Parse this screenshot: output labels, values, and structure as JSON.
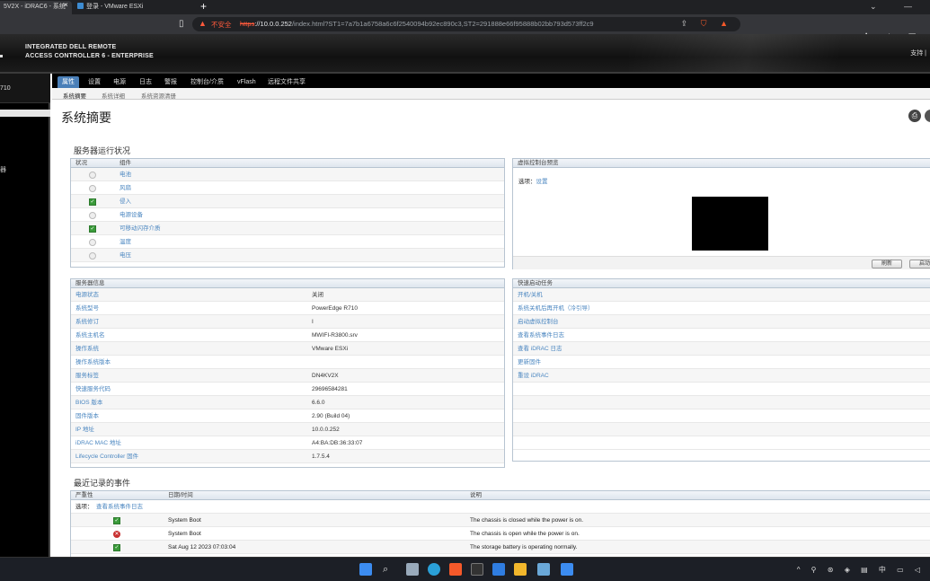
{
  "browser": {
    "tab1_title": "5V2X - iDRAC6 - 系统",
    "tab2_title": "登录 - VMware ESXi",
    "new_tab": "+",
    "close_x": "×",
    "security_label": "不安全",
    "url_scheme": "https",
    "url_host": "://10.0.0.252",
    "url_path": "/index.html?ST1=7a7b1a6758a6c6f2540094b92ec890c3,ST2=291888e66f95888b02bb793d573ff2c9"
  },
  "header": {
    "brand_line1": "INTEGRATED DELL REMOTE",
    "brand_line2": "ACCESS CONTROLLER 6 - ENTERPRISE",
    "support": "支持 |"
  },
  "sidebar": {
    "server_label": "710",
    "item_label": "器"
  },
  "tabs": [
    "属性",
    "设置",
    "电源",
    "日志",
    "警报",
    "控制台/介质",
    "vFlash",
    "远程文件共享"
  ],
  "subtabs": [
    "系统摘要",
    "系统详细",
    "系统资源清册"
  ],
  "page_title": "系统摘要",
  "health": {
    "section_title": "服务器运行状况",
    "col_status": "状况",
    "col_component": "组件",
    "rows": [
      {
        "status": "unknown",
        "name": "电池"
      },
      {
        "status": "unknown",
        "name": "风扇"
      },
      {
        "status": "ok",
        "name": "侵入"
      },
      {
        "status": "unknown",
        "name": "电源设备"
      },
      {
        "status": "ok",
        "name": "可移动闪存介质"
      },
      {
        "status": "unknown",
        "name": "温度"
      },
      {
        "status": "unknown",
        "name": "电压"
      }
    ]
  },
  "console_preview": {
    "title": "虚拟控制台预览",
    "options_label": "选项：",
    "options_link": "设置",
    "refresh_button": "刷新",
    "launch_button": "启动"
  },
  "server_info": {
    "title": "服务器信息",
    "rows": [
      {
        "label": "电源状态",
        "value": "关闭"
      },
      {
        "label": "系统型号",
        "value": "PowerEdge R710"
      },
      {
        "label": "系统修订",
        "value": "I"
      },
      {
        "label": "系统主机名",
        "value": "MWIFI-R3800.srv"
      },
      {
        "label": "操作系统",
        "value": "VMware ESXi"
      },
      {
        "label": "操作系统版本",
        "value": ""
      },
      {
        "label": "服务标签",
        "value": "DN4KV2X"
      },
      {
        "label": "快速服务代码",
        "value": "29696584281"
      },
      {
        "label": "BIOS 版本",
        "value": "6.6.0"
      },
      {
        "label": "固件版本",
        "value": "2.90 (Build 04)"
      },
      {
        "label": "IP 地址",
        "value": "10.0.0.252"
      },
      {
        "label": "iDRAC MAC 地址",
        "value": "A4:BA:DB:36:33:07"
      },
      {
        "label": "Lifecycle Controller 固件",
        "value": "1.7.5.4"
      }
    ]
  },
  "quick_launch": {
    "title": "快速启动任务",
    "items": [
      "开机/关机",
      "系统关机后再开机（冷引导）",
      "启动虚拟控制台",
      "查看系统事件日志",
      "查看 iDRAC 日志",
      "更新固件",
      "重设 iDRAC"
    ]
  },
  "events": {
    "section_title": "最近记录的事件",
    "col_severity": "严重性",
    "col_datetime": "日期/时间",
    "col_description": "说明",
    "options_label": "选项：",
    "options_link": "查看系统事件日志",
    "rows": [
      {
        "severity": "ok",
        "datetime": "System Boot",
        "description": "The chassis is closed while the power is on."
      },
      {
        "severity": "error",
        "datetime": "System Boot",
        "description": "The chassis is open while the power is on."
      },
      {
        "severity": "ok",
        "datetime": "Sat Aug 12 2023 07:03:04",
        "description": "The storage battery is operating normally."
      }
    ]
  },
  "colors": {
    "tab_active": "#4a7fb8",
    "link": "#4a86c0",
    "ok": "#3a9b3a",
    "error": "#c83030"
  }
}
